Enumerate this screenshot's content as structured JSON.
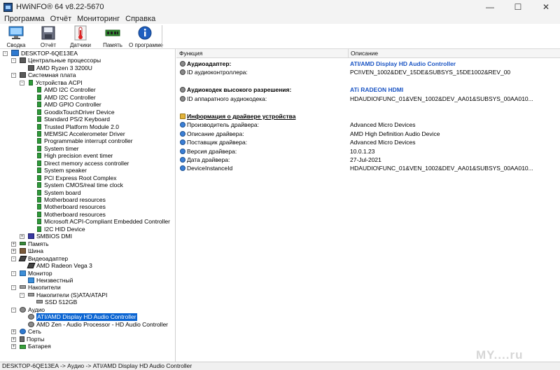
{
  "window": {
    "title": "HWiNFO® 64 v8.22-5670",
    "minimize": "—",
    "maximize": "☐",
    "close": "✕"
  },
  "menu": [
    "Программа",
    "Отчёт",
    "Мониторинг",
    "Справка"
  ],
  "toolbar": [
    {
      "label": "Сводка",
      "icon": "monitor-icon"
    },
    {
      "label": "Отчёт",
      "icon": "save-icon"
    },
    {
      "label": "Датчики",
      "icon": "thermometer-icon"
    },
    {
      "label": "Память",
      "icon": "memory-icon"
    },
    {
      "label": "О программе",
      "icon": "info-icon"
    }
  ],
  "tree": [
    {
      "label": "DESKTOP-6QE13EA",
      "icon": "pc"
    },
    {
      "label": "Центральные процессоры",
      "icon": "chip"
    },
    {
      "label": "AMD Ryzen 3 3200U",
      "icon": "chip"
    },
    {
      "label": "Системная плата",
      "icon": "chip"
    },
    {
      "label": "Устройства ACPI",
      "icon": "green"
    },
    {
      "label": "AMD I2C Controller",
      "icon": "green"
    },
    {
      "label": "AMD I2C Controller",
      "icon": "green"
    },
    {
      "label": "AMD GPIO Controller",
      "icon": "green"
    },
    {
      "label": "GoodixTouchDriver Device",
      "icon": "green"
    },
    {
      "label": "Standard PS/2 Keyboard",
      "icon": "green"
    },
    {
      "label": "Trusted Platform Module 2.0",
      "icon": "green"
    },
    {
      "label": "MEMSIC Accelerometer Driver",
      "icon": "green"
    },
    {
      "label": "Programmable interrupt controller",
      "icon": "green"
    },
    {
      "label": "System timer",
      "icon": "green"
    },
    {
      "label": "High precision event timer",
      "icon": "green"
    },
    {
      "label": "Direct memory access controller",
      "icon": "green"
    },
    {
      "label": "System speaker",
      "icon": "green"
    },
    {
      "label": "PCI Express Root Complex",
      "icon": "green"
    },
    {
      "label": "System CMOS/real time clock",
      "icon": "green"
    },
    {
      "label": "System board",
      "icon": "green"
    },
    {
      "label": "Motherboard resources",
      "icon": "green"
    },
    {
      "label": "Motherboard resources",
      "icon": "green"
    },
    {
      "label": "Motherboard resources",
      "icon": "green"
    },
    {
      "label": "Microsoft ACPI-Compliant Embedded Controller",
      "icon": "green"
    },
    {
      "label": "I2C HID Device",
      "icon": "green"
    },
    {
      "label": "SMBIOS DMI",
      "icon": "smb"
    },
    {
      "label": "Память",
      "icon": "ram"
    },
    {
      "label": "Шина",
      "icon": "bus"
    },
    {
      "label": "Видеоадаптер",
      "icon": "gpu"
    },
    {
      "label": "AMD Radeon Vega 3",
      "icon": "gpu"
    },
    {
      "label": "Монитор",
      "icon": "mon"
    },
    {
      "label": "Неизвестный",
      "icon": "mon"
    },
    {
      "label": "Накопители",
      "icon": "disk"
    },
    {
      "label": "Накопители (S)ATA/ATAPI",
      "icon": "disk"
    },
    {
      "label": "SSD 512GB",
      "icon": "disk"
    },
    {
      "label": "Аудио",
      "icon": "audio"
    },
    {
      "label": "ATI/AMD Display HD Audio Controller",
      "icon": "audio"
    },
    {
      "label": "AMD Zen - Audio Processor - HD Audio Controller",
      "icon": "audio"
    },
    {
      "label": "Сеть",
      "icon": "net"
    },
    {
      "label": "Порты",
      "icon": "port"
    },
    {
      "label": "Батарея",
      "icon": "bat"
    }
  ],
  "details": {
    "columns": [
      "Функция",
      "Описание"
    ],
    "rows": [
      {
        "key": "Аудиоадаптер:",
        "value": "ATI/AMD Display HD Audio Controller"
      },
      {
        "key": "ID аудиоконтроллера:",
        "value": "PCI\\VEN_1002&DEV_15DE&SUBSYS_15DE1002&REV_00"
      },
      {
        "key": "",
        "value": ""
      },
      {
        "key": "Аудиокодек высокого разрешения:",
        "value": "ATi RADEON HDMI"
      },
      {
        "key": "ID аппаратного аудиокодека:",
        "value": "HDAUDIO\\FUNC_01&VEN_1002&DEV_AA01&SUBSYS_00AA010..."
      },
      {
        "key": "",
        "value": ""
      },
      {
        "key": "Информация о драйвере устройства",
        "value": ""
      },
      {
        "key": "Производитель драйвера:",
        "value": "Advanced Micro Devices"
      },
      {
        "key": "Описание драйвера:",
        "value": "AMD High Definition Audio Device"
      },
      {
        "key": "Поставщик драйвера:",
        "value": "Advanced Micro Devices"
      },
      {
        "key": "Версия драйвера:",
        "value": "10.0.1.23"
      },
      {
        "key": "Дата драйвера:",
        "value": "27-Jul-2021"
      },
      {
        "key": "DeviceInstanceId",
        "value": "HDAUDIO\\FUNC_01&VEN_1002&DEV_AA01&SUBSYS_00AA010..."
      }
    ]
  },
  "statusbar": "DESKTOP-6QE13EA -> Аудио -> ATI/AMD Display HD Audio Controller",
  "watermark": "MY....ru"
}
